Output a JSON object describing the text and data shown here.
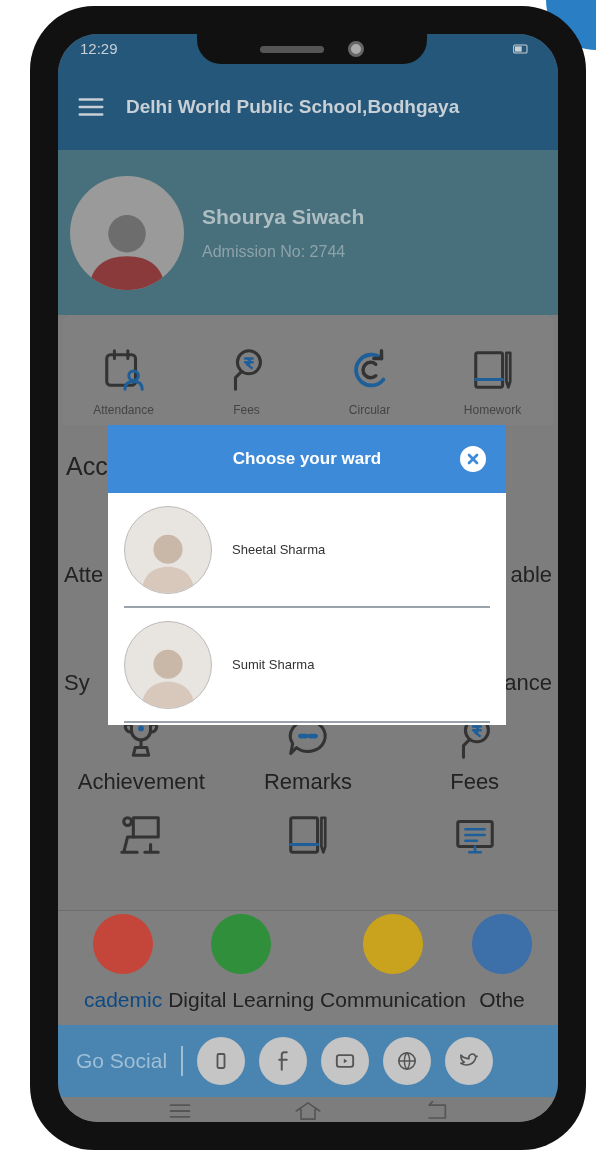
{
  "status_bar": {
    "time": "12:29"
  },
  "app_bar": {
    "title": "Delhi World Public School,Bodhgaya"
  },
  "profile": {
    "name": "Shourya Siwach",
    "admission": "Admission No: 2744"
  },
  "quick_links": [
    {
      "label": "Attendance",
      "kind": "calendar"
    },
    {
      "label": "Fees",
      "kind": "fees"
    },
    {
      "label": "Circular",
      "kind": "circular"
    },
    {
      "label": "Homework",
      "kind": "book"
    }
  ],
  "section_heading": "Acc",
  "hidden_rows": [
    {
      "left": "Atte",
      "right": "able"
    },
    {
      "left": "Sy",
      "right": "ance"
    }
  ],
  "grid_items": [
    {
      "label": "Achievement",
      "kind": "trophy"
    },
    {
      "label": "Remarks",
      "kind": "chat"
    },
    {
      "label": "Fees",
      "kind": "fees"
    },
    {
      "kind": "teacher"
    },
    {
      "kind": "book"
    },
    {
      "kind": "monitor"
    }
  ],
  "categories": [
    {
      "label": "cademic",
      "color": "#c4463a",
      "selected": true
    },
    {
      "label": "Digital Learning",
      "color": "#2f8f3a",
      "selected": false
    },
    {
      "label": "Communication",
      "color": "#c9a21e",
      "selected": false
    },
    {
      "label": "Othe",
      "color": "#3d6fa8",
      "selected": false
    }
  ],
  "social_bar": {
    "label": "Go Social",
    "icons": [
      {
        "kind": "app"
      },
      {
        "kind": "facebook"
      },
      {
        "kind": "youtube"
      },
      {
        "kind": "globe"
      },
      {
        "kind": "twitter"
      }
    ]
  },
  "dialog": {
    "title": "Choose your ward",
    "wards": [
      {
        "name": "Sheetal Sharma"
      },
      {
        "name": "Sumit Sharma"
      }
    ]
  }
}
